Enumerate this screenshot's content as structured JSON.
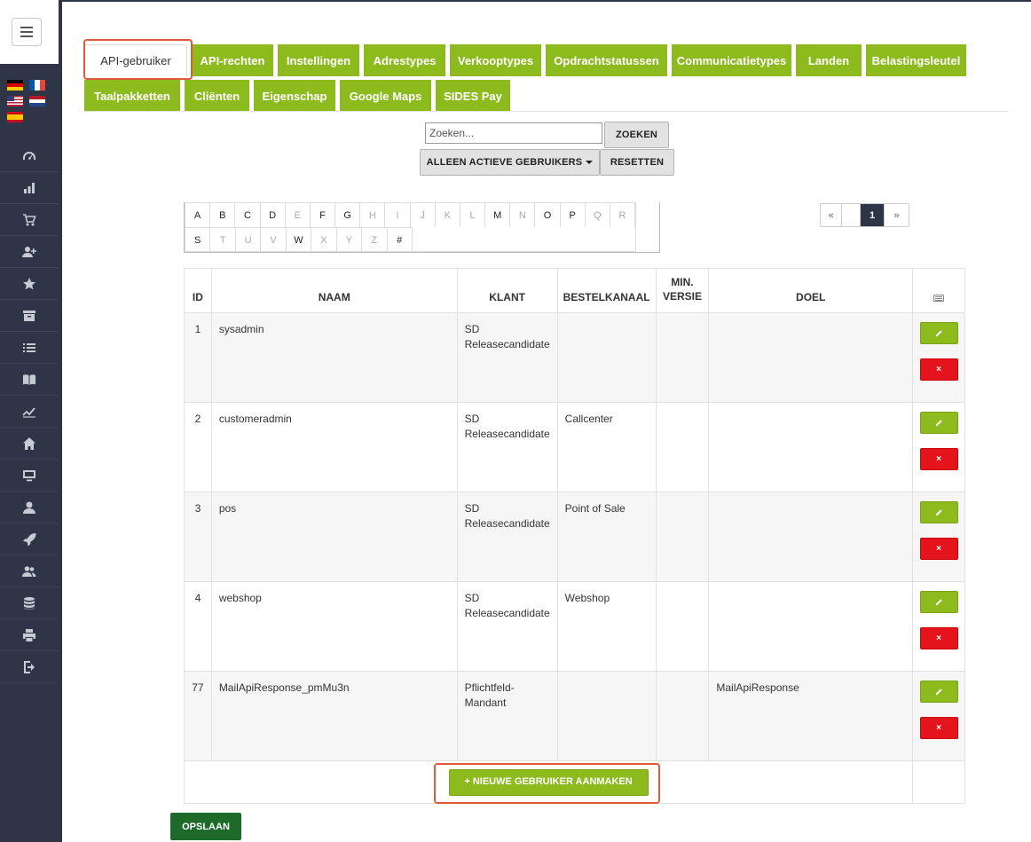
{
  "sidebar": {
    "menu_icon": "hamburger-icon",
    "flags": [
      "de-flag-icon",
      "fr-flag-icon",
      "us-flag-icon",
      "nl-flag-icon",
      "es-flag-icon"
    ],
    "nav_icons": [
      "dashboard-icon",
      "bar-chart-icon",
      "cart-icon",
      "add-user-icon",
      "star-icon",
      "archive-icon",
      "list-icon",
      "book-icon",
      "trend-icon",
      "home-icon",
      "monitor-icon",
      "user-icon",
      "rocket-icon",
      "users-icon",
      "database-icon",
      "print-icon",
      "logout-icon"
    ]
  },
  "tabs": {
    "row1": [
      "API-gebruiker",
      "API-rechten",
      "Instellingen",
      "Adrestypes",
      "Verkooptypes",
      "Opdrachtstatussen",
      "Communicatietypes",
      "Landen",
      "Belastingsleutel"
    ],
    "row2": [
      "Taalpakketten",
      "Cliënten",
      "Eigenschap",
      "Google Maps",
      "SIDES Pay"
    ],
    "active": "API-gebruiker"
  },
  "search": {
    "placeholder": "Zoeken...",
    "value": "",
    "search_label": "ZOEKEN",
    "filter_label": "ALLEEN ACTIEVE GEBRUIKERS",
    "reset_label": "RESETTEN"
  },
  "alphabet": {
    "row1": [
      "A",
      "B",
      "C",
      "D",
      "E",
      "F",
      "G",
      "H",
      "I",
      "J",
      "K",
      "L",
      "M",
      "N",
      "O",
      "P",
      "Q",
      "R"
    ],
    "row2": [
      "S",
      "T",
      "U",
      "V",
      "W",
      "X",
      "Y",
      "Z",
      "#"
    ],
    "enabled": [
      "A",
      "B",
      "C",
      "D",
      "F",
      "G",
      "M",
      "O",
      "P",
      "S",
      "W",
      "#"
    ]
  },
  "pagination": {
    "prev": "«",
    "current": "1",
    "next": "»"
  },
  "table": {
    "headers": {
      "id": "ID",
      "naam": "NAAM",
      "klant": "KLANT",
      "bestelkanaal": "BESTELKANAAL",
      "min_versie_line1": "MIN.",
      "min_versie_line2": "VERSIE",
      "doel": "DOEL",
      "actions_icon": "keyboard-icon"
    },
    "rows": [
      {
        "id": "1",
        "naam": "sysadmin",
        "klant": "SD Releasecandidate",
        "bestelkanaal": "",
        "min_versie": "",
        "doel": ""
      },
      {
        "id": "2",
        "naam": "customeradmin",
        "klant": "SD Releasecandidate",
        "bestelkanaal": "Callcenter",
        "min_versie": "",
        "doel": ""
      },
      {
        "id": "3",
        "naam": "pos",
        "klant": "SD Releasecandidate",
        "bestelkanaal": "Point of Sale",
        "min_versie": "",
        "doel": ""
      },
      {
        "id": "4",
        "naam": "webshop",
        "klant": "SD Releasecandidate",
        "bestelkanaal": "Webshop",
        "min_versie": "",
        "doel": ""
      },
      {
        "id": "77",
        "naam": "MailApiResponse_pmMu3n",
        "klant": "Pflichtfeld-Mandant",
        "bestelkanaal": "",
        "min_versie": "",
        "doel": "MailApiResponse"
      }
    ],
    "delete_label": "×",
    "new_user_label": "+ NIEUWE GEBRUIKER AANMAKEN"
  },
  "save_label": "OPSLAAN",
  "colors": {
    "accent_green": "#8dbb1e",
    "delete_red": "#e3141b",
    "save_green": "#1e6a2a",
    "sidebar": "#2d3546",
    "highlight": "#e05a3a"
  }
}
